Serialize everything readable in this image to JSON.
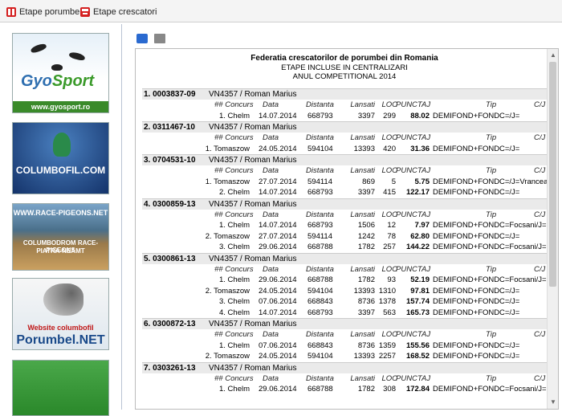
{
  "tabs": [
    {
      "label": "Etape porumbei"
    },
    {
      "label": "Etape crescatori"
    }
  ],
  "banners": {
    "gyosport": {
      "logo_a": "Gyo",
      "logo_b": "Sport",
      "url": "www.gyosport.ro"
    },
    "columbofil": {
      "text": "COLUMBOFIL.COM"
    },
    "racepigeons": {
      "top": "WWW.RACE-PIGEONS.NET",
      "line1": "COLUMBODROM RACE-PIGEONS",
      "line2": "PIATRA-NEAMT"
    },
    "porumbel": {
      "line1": "Website columbofil",
      "line2": "Porumbel.NET"
    }
  },
  "report": {
    "title": "Federatia crescatorilor de porumbei din Romania",
    "subtitle1": "ETAPE INCLUSE IN CENTRALIZARI",
    "subtitle2": "ANUL COMPETITIONAL 2014",
    "headers": {
      "nr": "## Concurs",
      "data": "Data",
      "distanta": "Distanta",
      "lansati": "Lansati",
      "loc": "LOC",
      "punctaj": "PUNCTAJ",
      "tip": "Tip",
      "cj": "C/J"
    },
    "groups": [
      {
        "id": "1. 0003837-09",
        "owner": "VN4357 / Roman Marius",
        "rows": [
          {
            "concurs": "1. Chelm",
            "data": "14.07.2014",
            "distanta": "668793",
            "lansati": "3397",
            "loc": "299",
            "punctaj": "88.02",
            "tip": "DEMIFOND+FOND",
            "cj": "C=/J="
          }
        ]
      },
      {
        "id": "2. 0311467-10",
        "owner": "VN4357 / Roman Marius",
        "rows": [
          {
            "concurs": "1. Tomaszow",
            "data": "24.05.2014",
            "distanta": "594104",
            "lansati": "13393",
            "loc": "420",
            "punctaj": "31.36",
            "tip": "DEMIFOND+FOND",
            "cj": "C=/J="
          }
        ]
      },
      {
        "id": "3. 0704531-10",
        "owner": "VN4357 / Roman Marius",
        "rows": [
          {
            "concurs": "1. Tomaszow",
            "data": "27.07.2014",
            "distanta": "594114",
            "lansati": "869",
            "loc": "5",
            "punctaj": "5.75",
            "tip": "DEMIFOND+FOND",
            "cj": "C=/J=Vrancea"
          },
          {
            "concurs": "2. Chelm",
            "data": "14.07.2014",
            "distanta": "668793",
            "lansati": "3397",
            "loc": "415",
            "punctaj": "122.17",
            "tip": "DEMIFOND+FOND",
            "cj": "C=/J="
          }
        ]
      },
      {
        "id": "4. 0300859-13",
        "owner": "VN4357 / Roman Marius",
        "rows": [
          {
            "concurs": "1. Chelm",
            "data": "14.07.2014",
            "distanta": "668793",
            "lansati": "1506",
            "loc": "12",
            "punctaj": "7.97",
            "tip": "DEMIFOND+FOND",
            "cj": "C=Focsani/J="
          },
          {
            "concurs": "2. Tomaszow",
            "data": "27.07.2014",
            "distanta": "594114",
            "lansati": "1242",
            "loc": "78",
            "punctaj": "62.80",
            "tip": "DEMIFOND+FOND",
            "cj": "C=/J="
          },
          {
            "concurs": "3. Chelm",
            "data": "29.06.2014",
            "distanta": "668788",
            "lansati": "1782",
            "loc": "257",
            "punctaj": "144.22",
            "tip": "DEMIFOND+FOND",
            "cj": "C=Focsani/J="
          }
        ]
      },
      {
        "id": "5. 0300861-13",
        "owner": "VN4357 / Roman Marius",
        "rows": [
          {
            "concurs": "1. Chelm",
            "data": "29.06.2014",
            "distanta": "668788",
            "lansati": "1782",
            "loc": "93",
            "punctaj": "52.19",
            "tip": "DEMIFOND+FOND",
            "cj": "C=Focsani/J="
          },
          {
            "concurs": "2. Tomaszow",
            "data": "24.05.2014",
            "distanta": "594104",
            "lansati": "13393",
            "loc": "1310",
            "punctaj": "97.81",
            "tip": "DEMIFOND+FOND",
            "cj": "C=/J="
          },
          {
            "concurs": "3. Chelm",
            "data": "07.06.2014",
            "distanta": "668843",
            "lansati": "8736",
            "loc": "1378",
            "punctaj": "157.74",
            "tip": "DEMIFOND+FOND",
            "cj": "C=/J="
          },
          {
            "concurs": "4. Chelm",
            "data": "14.07.2014",
            "distanta": "668793",
            "lansati": "3397",
            "loc": "563",
            "punctaj": "165.73",
            "tip": "DEMIFOND+FOND",
            "cj": "C=/J="
          }
        ]
      },
      {
        "id": "6. 0300872-13",
        "owner": "VN4357 / Roman Marius",
        "rows": [
          {
            "concurs": "1. Chelm",
            "data": "07.06.2014",
            "distanta": "668843",
            "lansati": "8736",
            "loc": "1359",
            "punctaj": "155.56",
            "tip": "DEMIFOND+FOND",
            "cj": "C=/J="
          },
          {
            "concurs": "2. Tomaszow",
            "data": "24.05.2014",
            "distanta": "594104",
            "lansati": "13393",
            "loc": "2257",
            "punctaj": "168.52",
            "tip": "DEMIFOND+FOND",
            "cj": "C=/J="
          }
        ]
      },
      {
        "id": "7. 0303261-13",
        "owner": "VN4357 / Roman Marius",
        "rows": [
          {
            "concurs": "1. Chelm",
            "data": "29.06.2014",
            "distanta": "668788",
            "lansati": "1782",
            "loc": "308",
            "punctaj": "172.84",
            "tip": "DEMIFOND+FOND",
            "cj": "C=Focsani/J="
          }
        ]
      }
    ]
  }
}
